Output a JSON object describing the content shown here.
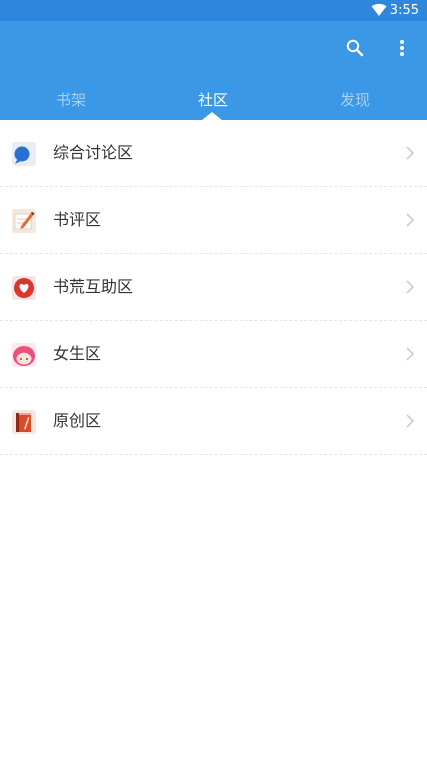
{
  "status_bar": {
    "time": "3:55",
    "wifi_icon": "wifi-icon"
  },
  "app_bar": {
    "search_icon": "search-icon",
    "more_icon": "more-vertical-icon",
    "accent_color": "#3a98e6"
  },
  "tabs": [
    {
      "label": "书架",
      "active": false
    },
    {
      "label": "社区",
      "active": true
    },
    {
      "label": "发现",
      "active": false
    }
  ],
  "community_items": [
    {
      "label": "综合讨论区",
      "icon": "chat-bubble-icon"
    },
    {
      "label": "书评区",
      "icon": "pencil-note-icon"
    },
    {
      "label": "书荒互助区",
      "icon": "heart-icon"
    },
    {
      "label": "女生区",
      "icon": "girl-face-icon"
    },
    {
      "label": "原创区",
      "icon": "book-icon"
    }
  ]
}
